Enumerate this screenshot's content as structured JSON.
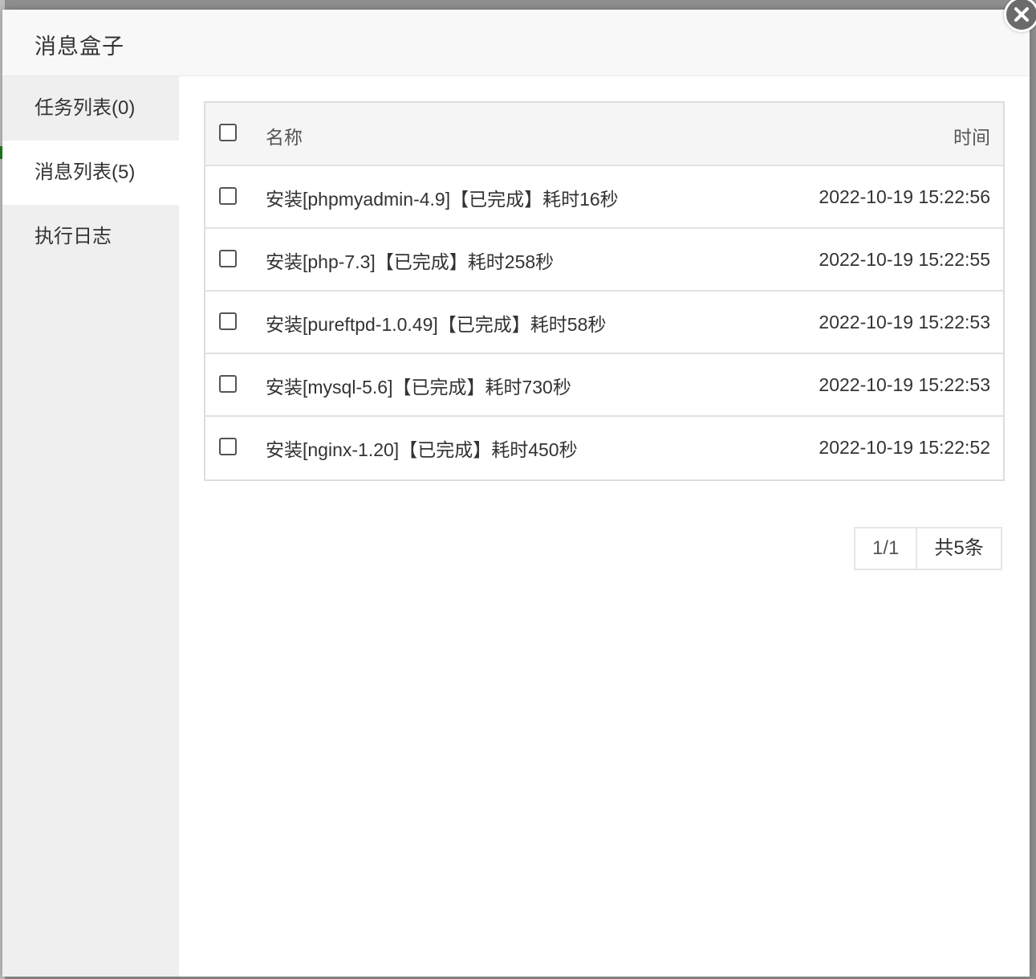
{
  "dialog": {
    "title": "消息盒子"
  },
  "sidebar": {
    "items": [
      {
        "label": "任务列表(0)"
      },
      {
        "label": "消息列表(5)"
      },
      {
        "label": "执行日志"
      }
    ],
    "active_index": 1
  },
  "table": {
    "columns": {
      "name": "名称",
      "time": "时间"
    },
    "rows": [
      {
        "name": "安装[phpmyadmin-4.9]【已完成】耗时16秒",
        "time": "2022-10-19 15:22:56"
      },
      {
        "name": "安装[php-7.3]【已完成】耗时258秒",
        "time": "2022-10-19 15:22:55"
      },
      {
        "name": "安装[pureftpd-1.0.49]【已完成】耗时58秒",
        "time": "2022-10-19 15:22:53"
      },
      {
        "name": "安装[mysql-5.6]【已完成】耗时730秒",
        "time": "2022-10-19 15:22:53"
      },
      {
        "name": "安装[nginx-1.20]【已完成】耗时450秒",
        "time": "2022-10-19 15:22:52"
      }
    ]
  },
  "pager": {
    "page": "1/1",
    "total": "共5条"
  },
  "icons": {
    "close": "close-icon",
    "checkbox": "checkbox-icon"
  },
  "colors": {
    "sidebar_bg": "#efefef",
    "header_bg": "#f5f5f5",
    "close_bg": "#6b6b6b"
  }
}
